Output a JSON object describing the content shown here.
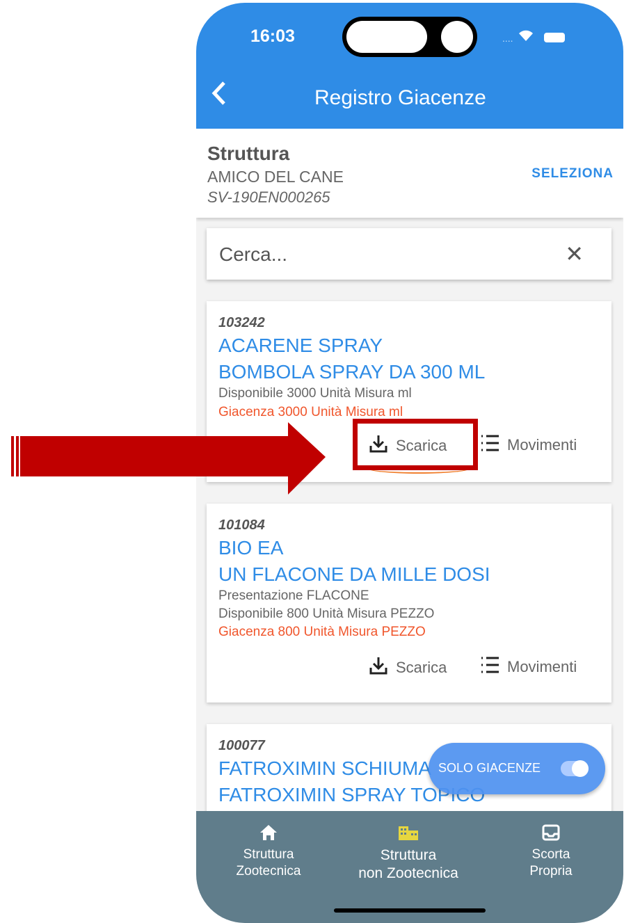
{
  "status_bar": {
    "time": "16:03",
    "signal": "....",
    "wifi": "ᯤ"
  },
  "header": {
    "back_icon": "chevron-left-icon",
    "title": "Registro Giacenze"
  },
  "struttura": {
    "heading": "Struttura",
    "name": "AMICO DEL CANE",
    "code": "SV-190EN000265",
    "select_label": "SELEZIONA"
  },
  "search": {
    "placeholder": "Cerca...",
    "value": "",
    "clear_icon": "close-icon"
  },
  "products": [
    {
      "code": "103242",
      "name_line1": "ACARENE SPRAY",
      "name_line2": "BOMBOLA SPRAY DA 300 ML",
      "disponibile": "Disponibile  3000 Unità Misura  ml",
      "giacenza": "Giacenza  3000 Unità Misura  ml",
      "scarica_label": "Scarica",
      "movimenti_label": "Movimenti"
    },
    {
      "code": "101084",
      "name_line1": "BIO EA",
      "name_line2": "UN FLACONE DA MILLE DOSI",
      "presentazione": "Presentazione FLACONE",
      "disponibile": "Disponibile  800 Unità Misura  PEZZO",
      "giacenza": "Giacenza  800 Unità Misura  PEZZO",
      "scarica_label": "Scarica",
      "movimenti_label": "Movimenti"
    },
    {
      "code": "100077",
      "name_line1": "FATROXIMIN SCHIUMA",
      "name_line2": "FATROXIMIN SPRAY TOPICO"
    }
  ],
  "fab": {
    "label": "SOLO GIACENZE",
    "toggle_on": true
  },
  "bottom_nav": [
    {
      "icon": "home-icon",
      "line1": "Struttura",
      "line2": "Zootecnica"
    },
    {
      "icon": "building-icon",
      "line1": "Struttura",
      "line2": "non Zootecnica"
    },
    {
      "icon": "inbox-icon",
      "line1": "Scorta",
      "line2": "Propria"
    }
  ],
  "colors": {
    "primary": "#2f8ce6",
    "alert": "#f0562c",
    "nav_bg": "#607d8b",
    "annotation": "#c00000"
  }
}
